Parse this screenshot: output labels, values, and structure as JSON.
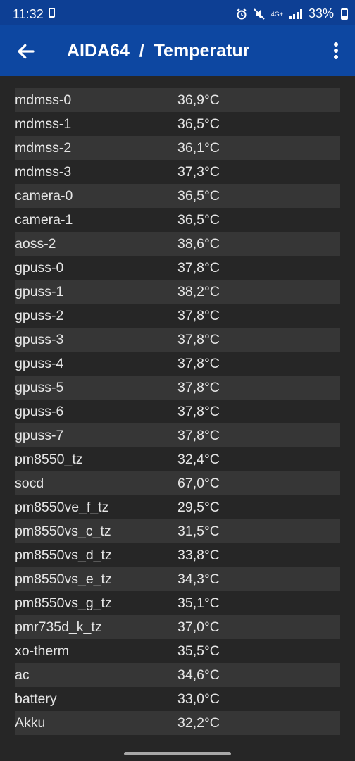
{
  "status": {
    "time": "11:32",
    "battery": "33%",
    "network": "4G+"
  },
  "appbar": {
    "title": "AIDA64  /  Temperatur"
  },
  "sensors": [
    {
      "name": "mdmss-0",
      "value": "36,9°C"
    },
    {
      "name": "mdmss-1",
      "value": "36,5°C"
    },
    {
      "name": "mdmss-2",
      "value": "36,1°C"
    },
    {
      "name": "mdmss-3",
      "value": "37,3°C"
    },
    {
      "name": "camera-0",
      "value": "36,5°C"
    },
    {
      "name": "camera-1",
      "value": "36,5°C"
    },
    {
      "name": "aoss-2",
      "value": "38,6°C"
    },
    {
      "name": "gpuss-0",
      "value": "37,8°C"
    },
    {
      "name": "gpuss-1",
      "value": "38,2°C"
    },
    {
      "name": "gpuss-2",
      "value": "37,8°C"
    },
    {
      "name": "gpuss-3",
      "value": "37,8°C"
    },
    {
      "name": "gpuss-4",
      "value": "37,8°C"
    },
    {
      "name": "gpuss-5",
      "value": "37,8°C"
    },
    {
      "name": "gpuss-6",
      "value": "37,8°C"
    },
    {
      "name": "gpuss-7",
      "value": "37,8°C"
    },
    {
      "name": "pm8550_tz",
      "value": "32,4°C"
    },
    {
      "name": "socd",
      "value": "67,0°C"
    },
    {
      "name": "pm8550ve_f_tz",
      "value": "29,5°C"
    },
    {
      "name": "pm8550vs_c_tz",
      "value": "31,5°C"
    },
    {
      "name": "pm8550vs_d_tz",
      "value": "33,8°C"
    },
    {
      "name": "pm8550vs_e_tz",
      "value": "34,3°C"
    },
    {
      "name": "pm8550vs_g_tz",
      "value": "35,1°C"
    },
    {
      "name": "pmr735d_k_tz",
      "value": "37,0°C"
    },
    {
      "name": "xo-therm",
      "value": "35,5°C"
    },
    {
      "name": "ac",
      "value": "34,6°C"
    },
    {
      "name": "battery",
      "value": "33,0°C"
    },
    {
      "name": "Akku",
      "value": "32,2°C"
    }
  ]
}
